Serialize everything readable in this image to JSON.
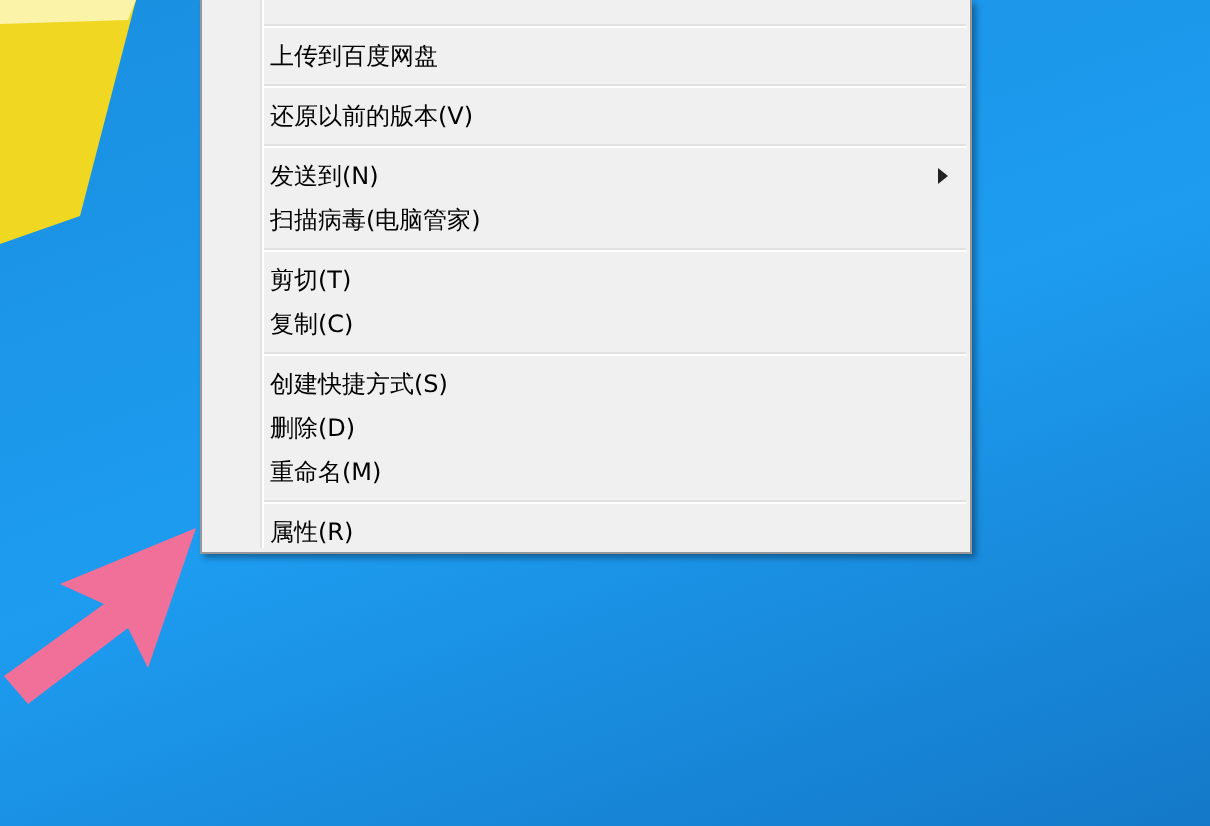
{
  "context_menu": {
    "groups": [
      {
        "items": [
          {
            "label": "上传到百度网盘",
            "submenu": false
          }
        ]
      },
      {
        "items": [
          {
            "label": "还原以前的版本(V)",
            "submenu": false
          }
        ]
      },
      {
        "items": [
          {
            "label": "发送到(N)",
            "submenu": true
          },
          {
            "label": "扫描病毒(电脑管家)",
            "submenu": false
          }
        ]
      },
      {
        "items": [
          {
            "label": "剪切(T)",
            "submenu": false
          },
          {
            "label": "复制(C)",
            "submenu": false
          }
        ]
      },
      {
        "items": [
          {
            "label": "创建快捷方式(S)",
            "submenu": false
          },
          {
            "label": "删除(D)",
            "submenu": false
          },
          {
            "label": "重命名(M)",
            "submenu": false
          }
        ]
      },
      {
        "items": [
          {
            "label": "属性(R)",
            "submenu": false
          }
        ]
      }
    ]
  }
}
